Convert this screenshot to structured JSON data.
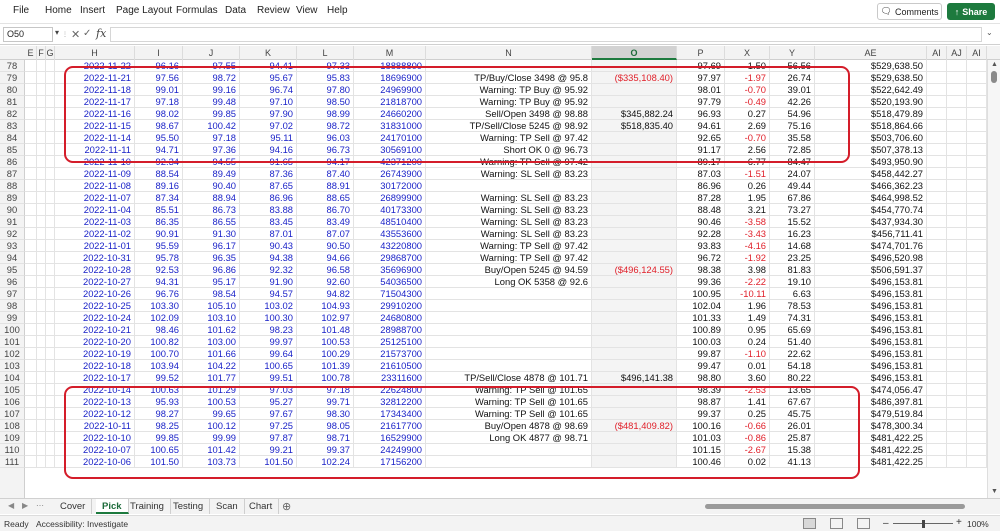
{
  "menu": {
    "items": [
      "File",
      "Home",
      "Insert",
      "Page Layout",
      "Formulas",
      "Data",
      "Review",
      "View",
      "Help"
    ],
    "comments_label": "Comments",
    "share_label": "Share"
  },
  "formula_bar": {
    "name_box": "O50",
    "fx": "fx",
    "formula": ""
  },
  "columns": [
    {
      "id": "E",
      "selected": false
    },
    {
      "id": "F",
      "selected": false
    },
    {
      "id": "G",
      "selected": false
    },
    {
      "id": "H",
      "selected": false
    },
    {
      "id": "I",
      "selected": false
    },
    {
      "id": "J",
      "selected": false
    },
    {
      "id": "K",
      "selected": false
    },
    {
      "id": "L",
      "selected": false
    },
    {
      "id": "M",
      "selected": false
    },
    {
      "id": "N",
      "selected": false
    },
    {
      "id": "O",
      "selected": true
    },
    {
      "id": "P",
      "selected": false
    },
    {
      "id": "X",
      "selected": false
    },
    {
      "id": "Y",
      "selected": false
    },
    {
      "id": "AE",
      "selected": false
    },
    {
      "id": "AI",
      "selected": false
    },
    {
      "id": "AJ",
      "selected": false
    },
    {
      "id": "AI",
      "selected": false
    }
  ],
  "rows": [
    {
      "n": "78",
      "date": "2022-11-22",
      "open": "96.16",
      "high": "97.55",
      "low": "94.41",
      "close": "97.33",
      "volume": "18888800",
      "signal": "",
      "pnl": "",
      "p": "97.69",
      "x": "1.50",
      "y": "56.56",
      "ae": "$529,638.50"
    },
    {
      "n": "79",
      "date": "2022-11-21",
      "open": "97.56",
      "high": "98.72",
      "low": "95.67",
      "close": "95.83",
      "volume": "18696900",
      "signal": "TP/Buy/Close 3498 @ 95.8",
      "pnl": "($335,108.40)",
      "p": "97.97",
      "x": "-1.97",
      "y": "26.74",
      "ae": "$529,638.50"
    },
    {
      "n": "80",
      "date": "2022-11-18",
      "open": "99.01",
      "high": "99.16",
      "low": "96.74",
      "close": "97.80",
      "volume": "24969900",
      "signal": "Warning: TP Buy @ 95.92",
      "pnl": "",
      "p": "98.01",
      "x": "-0.70",
      "y": "39.01",
      "ae": "$522,642.49"
    },
    {
      "n": "81",
      "date": "2022-11-17",
      "open": "97.18",
      "high": "99.48",
      "low": "97.10",
      "close": "98.50",
      "volume": "21818700",
      "signal": "Warning: TP Buy @ 95.92",
      "pnl": "",
      "p": "97.79",
      "x": "-0.49",
      "y": "42.26",
      "ae": "$520,193.90"
    },
    {
      "n": "82",
      "date": "2022-11-16",
      "open": "98.02",
      "high": "99.85",
      "low": "97.90",
      "close": "98.99",
      "volume": "24660200",
      "signal": "Sell/Open 3498 @ 98.88",
      "pnl": "$345,882.24",
      "p": "96.93",
      "x": "0.27",
      "y": "54.96",
      "ae": "$518,479.89"
    },
    {
      "n": "83",
      "date": "2022-11-15",
      "open": "98.67",
      "high": "100.42",
      "low": "97.02",
      "close": "98.72",
      "volume": "31831000",
      "signal": "TP/Sell/Close 5245 @ 98.92",
      "pnl": "$518,835.40",
      "p": "94.61",
      "x": "2.69",
      "y": "75.16",
      "ae": "$518,864.66"
    },
    {
      "n": "84",
      "date": "2022-11-14",
      "open": "95.50",
      "high": "97.18",
      "low": "95.11",
      "close": "96.03",
      "volume": "24170100",
      "signal": "Warning: TP Sell @ 97.42",
      "pnl": "",
      "p": "92.65",
      "x": "-0.70",
      "y": "35.58",
      "ae": "$503,706.60"
    },
    {
      "n": "85",
      "date": "2022-11-11",
      "open": "94.71",
      "high": "97.36",
      "low": "94.16",
      "close": "96.73",
      "volume": "30569100",
      "signal": "Short OK 0 @ 96.73",
      "pnl": "",
      "p": "91.17",
      "x": "2.56",
      "y": "72.85",
      "ae": "$507,378.13"
    },
    {
      "n": "86",
      "date": "2022-11-10",
      "open": "92.34",
      "high": "94.55",
      "low": "91.65",
      "close": "94.17",
      "volume": "42371200",
      "signal": "Warning: TP Sell @ 97.42",
      "pnl": "",
      "p": "89.17",
      "x": "6.77",
      "y": "84.47",
      "ae": "$493,950.90"
    },
    {
      "n": "87",
      "date": "2022-11-09",
      "open": "88.54",
      "high": "89.49",
      "low": "87.36",
      "close": "87.40",
      "volume": "26743900",
      "signal": "Warning: SL Sell @ 83.23",
      "pnl": "",
      "p": "87.03",
      "x": "-1.51",
      "y": "24.07",
      "ae": "$458,442.27"
    },
    {
      "n": "88",
      "date": "2022-11-08",
      "open": "89.16",
      "high": "90.40",
      "low": "87.65",
      "close": "88.91",
      "volume": "30172000",
      "signal": "",
      "pnl": "",
      "p": "86.96",
      "x": "0.26",
      "y": "49.44",
      "ae": "$466,362.23"
    },
    {
      "n": "89",
      "date": "2022-11-07",
      "open": "87.34",
      "high": "88.94",
      "low": "86.96",
      "close": "88.65",
      "volume": "26899900",
      "signal": "Warning: SL Sell @ 83.23",
      "pnl": "",
      "p": "87.28",
      "x": "1.95",
      "y": "67.86",
      "ae": "$464,998.52"
    },
    {
      "n": "90",
      "date": "2022-11-04",
      "open": "85.51",
      "high": "86.73",
      "low": "83.88",
      "close": "86.70",
      "volume": "40173300",
      "signal": "Warning: SL Sell @ 83.23",
      "pnl": "",
      "p": "88.48",
      "x": "3.21",
      "y": "73.27",
      "ae": "$454,770.74"
    },
    {
      "n": "91",
      "date": "2022-11-03",
      "open": "86.35",
      "high": "86.55",
      "low": "83.45",
      "close": "83.49",
      "volume": "48510400",
      "signal": "Warning: SL Sell @ 83.23",
      "pnl": "",
      "p": "90.46",
      "x": "-3.58",
      "y": "15.52",
      "ae": "$437,934.30"
    },
    {
      "n": "92",
      "date": "2022-11-02",
      "open": "90.91",
      "high": "91.30",
      "low": "87.01",
      "close": "87.07",
      "volume": "43553600",
      "signal": "Warning: SL Sell @ 83.23",
      "pnl": "",
      "p": "92.28",
      "x": "-3.43",
      "y": "16.23",
      "ae": "$456,711.41"
    },
    {
      "n": "93",
      "date": "2022-11-01",
      "open": "95.59",
      "high": "96.17",
      "low": "90.43",
      "close": "90.50",
      "volume": "43220800",
      "signal": "Warning: TP Sell @ 97.42",
      "pnl": "",
      "p": "93.83",
      "x": "-4.16",
      "y": "14.68",
      "ae": "$474,701.76"
    },
    {
      "n": "94",
      "date": "2022-10-31",
      "open": "95.78",
      "high": "96.35",
      "low": "94.38",
      "close": "94.66",
      "volume": "29868700",
      "signal": "Warning: TP Sell @ 97.42",
      "pnl": "",
      "p": "96.72",
      "x": "-1.92",
      "y": "23.25",
      "ae": "$496,520.98"
    },
    {
      "n": "95",
      "date": "2022-10-28",
      "open": "92.53",
      "high": "96.86",
      "low": "92.32",
      "close": "96.58",
      "volume": "35696900",
      "signal": "Buy/Open 5245 @ 94.59",
      "pnl": "($496,124.55)",
      "p": "98.38",
      "x": "3.98",
      "y": "81.83",
      "ae": "$506,591.37"
    },
    {
      "n": "96",
      "date": "2022-10-27",
      "open": "94.31",
      "high": "95.17",
      "low": "91.90",
      "close": "92.60",
      "volume": "54036500",
      "signal": "Long OK 5358 @ 92.6",
      "pnl": "",
      "p": "99.36",
      "x": "-2.22",
      "y": "19.10",
      "ae": "$496,153.81"
    },
    {
      "n": "97",
      "date": "2022-10-26",
      "open": "96.76",
      "high": "98.54",
      "low": "94.57",
      "close": "94.82",
      "volume": "71504300",
      "signal": "",
      "pnl": "",
      "p": "100.95",
      "x": "-10.11",
      "y": "6.63",
      "ae": "$496,153.81"
    },
    {
      "n": "98",
      "date": "2022-10-25",
      "open": "103.30",
      "high": "105.10",
      "low": "103.02",
      "close": "104.93",
      "volume": "29910200",
      "signal": "",
      "pnl": "",
      "p": "102.04",
      "x": "1.96",
      "y": "78.53",
      "ae": "$496,153.81"
    },
    {
      "n": "99",
      "date": "2022-10-24",
      "open": "102.09",
      "high": "103.10",
      "low": "100.30",
      "close": "102.97",
      "volume": "24680800",
      "signal": "",
      "pnl": "",
      "p": "101.33",
      "x": "1.49",
      "y": "74.31",
      "ae": "$496,153.81"
    },
    {
      "n": "100",
      "date": "2022-10-21",
      "open": "98.46",
      "high": "101.62",
      "low": "98.23",
      "close": "101.48",
      "volume": "28988700",
      "signal": "",
      "pnl": "",
      "p": "100.89",
      "x": "0.95",
      "y": "65.69",
      "ae": "$496,153.81"
    },
    {
      "n": "101",
      "date": "2022-10-20",
      "open": "100.82",
      "high": "103.00",
      "low": "99.97",
      "close": "100.53",
      "volume": "25125100",
      "signal": "",
      "pnl": "",
      "p": "100.03",
      "x": "0.24",
      "y": "51.40",
      "ae": "$496,153.81"
    },
    {
      "n": "102",
      "date": "2022-10-19",
      "open": "100.70",
      "high": "101.66",
      "low": "99.64",
      "close": "100.29",
      "volume": "21573700",
      "signal": "",
      "pnl": "",
      "p": "99.87",
      "x": "-1.10",
      "y": "22.62",
      "ae": "$496,153.81"
    },
    {
      "n": "103",
      "date": "2022-10-18",
      "open": "103.94",
      "high": "104.22",
      "low": "100.65",
      "close": "101.39",
      "volume": "21610500",
      "signal": "",
      "pnl": "",
      "p": "99.47",
      "x": "0.01",
      "y": "54.18",
      "ae": "$496,153.81"
    },
    {
      "n": "104",
      "date": "2022-10-17",
      "open": "99.52",
      "high": "101.77",
      "low": "99.51",
      "close": "100.78",
      "volume": "23311600",
      "signal": "TP/Sell/Close 4878 @ 101.71",
      "pnl": "$496,141.38",
      "p": "98.80",
      "x": "3.60",
      "y": "80.22",
      "ae": "$496,153.81"
    },
    {
      "n": "105",
      "date": "2022-10-14",
      "open": "100.63",
      "high": "101.29",
      "low": "97.03",
      "close": "97.18",
      "volume": "22624800",
      "signal": "Warning: TP Sell @ 101.65",
      "pnl": "",
      "p": "98.39",
      "x": "-2.53",
      "y": "13.65",
      "ae": "$474,056.47"
    },
    {
      "n": "106",
      "date": "2022-10-13",
      "open": "95.93",
      "high": "100.53",
      "low": "95.27",
      "close": "99.71",
      "volume": "32812200",
      "signal": "Warning: TP Sell @ 101.65",
      "pnl": "",
      "p": "98.87",
      "x": "1.41",
      "y": "67.67",
      "ae": "$486,397.81"
    },
    {
      "n": "107",
      "date": "2022-10-12",
      "open": "98.27",
      "high": "99.65",
      "low": "97.67",
      "close": "98.30",
      "volume": "17343400",
      "signal": "Warning: TP Sell @ 101.65",
      "pnl": "",
      "p": "99.37",
      "x": "0.25",
      "y": "45.75",
      "ae": "$479,519.84"
    },
    {
      "n": "108",
      "date": "2022-10-11",
      "open": "98.25",
      "high": "100.12",
      "low": "97.25",
      "close": "98.05",
      "volume": "21617700",
      "signal": "Buy/Open 4878 @ 98.69",
      "pnl": "($481,409.82)",
      "p": "100.16",
      "x": "-0.66",
      "y": "26.01",
      "ae": "$478,300.34"
    },
    {
      "n": "109",
      "date": "2022-10-10",
      "open": "99.85",
      "high": "99.99",
      "low": "97.87",
      "close": "98.71",
      "volume": "16529900",
      "signal": "Long OK 4877 @ 98.71",
      "pnl": "",
      "p": "101.03",
      "x": "-0.86",
      "y": "25.87",
      "ae": "$481,422.25"
    },
    {
      "n": "110",
      "date": "2022-10-07",
      "open": "100.65",
      "high": "101.42",
      "low": "99.21",
      "close": "99.37",
      "volume": "24249900",
      "signal": "",
      "pnl": "",
      "p": "101.15",
      "x": "-2.67",
      "y": "15.38",
      "ae": "$481,422.25"
    },
    {
      "n": "111",
      "date": "2022-10-06",
      "open": "101.50",
      "high": "103.73",
      "low": "101.50",
      "close": "102.24",
      "volume": "17156200",
      "signal": "",
      "pnl": "",
      "p": "100.46",
      "x": "0.02",
      "y": "41.13",
      "ae": "$481,422.25"
    }
  ],
  "sheet_tabs": [
    {
      "label": "Cover",
      "active": false
    },
    {
      "label": "Pick",
      "active": true
    },
    {
      "label": "Training",
      "active": false
    },
    {
      "label": "Testing",
      "active": false
    },
    {
      "label": "Scan",
      "active": false
    },
    {
      "label": "Chart",
      "active": false
    }
  ],
  "status": {
    "ready": "Ready",
    "accessibility": "Accessibility: Investigate",
    "zoom": "100%"
  },
  "colors": {
    "accent": "#1d7a3e",
    "highlight_oval": "#d41d2a",
    "price_text": "#1a22c8",
    "negative": "#e0202a"
  }
}
